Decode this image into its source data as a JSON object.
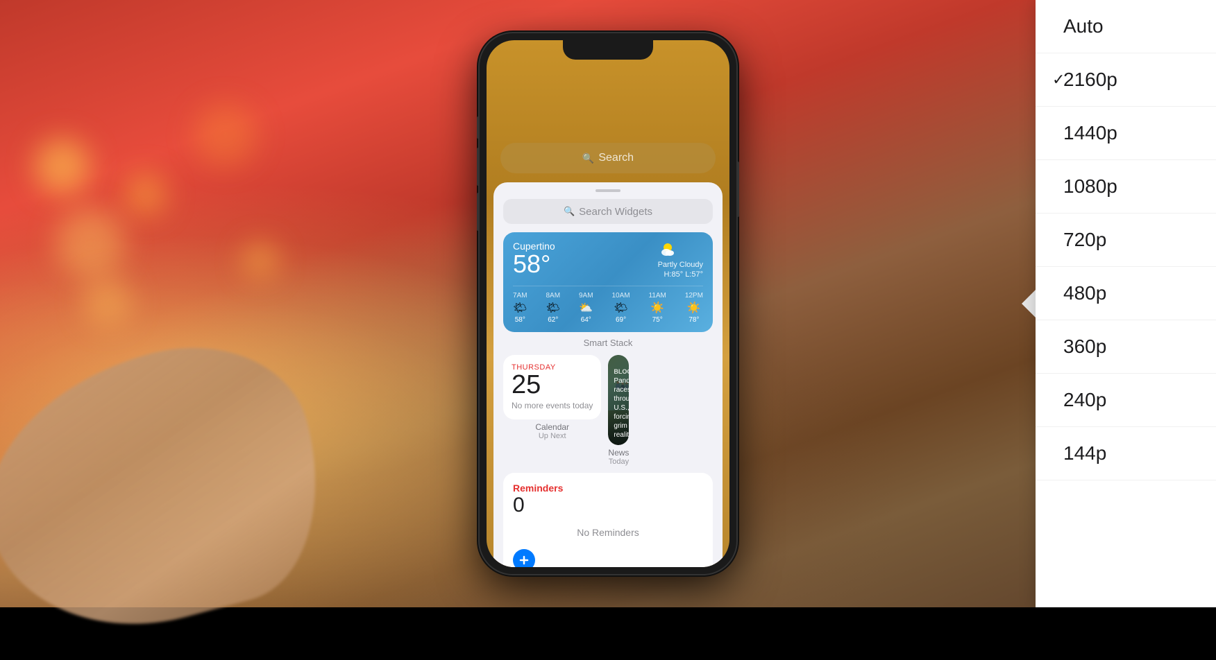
{
  "background": {
    "description": "Blurred desk with bokeh lights and warm tones"
  },
  "phone": {
    "search_text": "Search",
    "search_widgets_text": "Search Widgets",
    "weather": {
      "city": "Cupertino",
      "temperature": "58°",
      "condition": "Partly Cloudy",
      "high": "H:85°",
      "low": "L:57°",
      "forecast": [
        {
          "time": "7AM",
          "temp": "58°",
          "icon": "🌤"
        },
        {
          "time": "8AM",
          "temp": "62°",
          "icon": "🌤"
        },
        {
          "time": "9AM",
          "temp": "64°",
          "icon": "⛅"
        },
        {
          "time": "10AM",
          "temp": "69°",
          "icon": "🌤"
        },
        {
          "time": "11AM",
          "temp": "75°",
          "icon": "☀️"
        },
        {
          "time": "12PM",
          "temp": "78°",
          "icon": "☀️"
        }
      ]
    },
    "smart_stack_label": "Smart Stack",
    "calendar": {
      "day": "THURSDAY",
      "date": "25",
      "no_events": "No more events today",
      "label": "Calendar",
      "sublabel": "Up Next"
    },
    "news": {
      "source": "Bloomberg",
      "headline": "Pandemic races through U.S., forcing grim realit...",
      "label": "News",
      "sublabel": "Today"
    },
    "reminders": {
      "title": "Reminders",
      "count": "0",
      "no_reminders": "No Reminders",
      "label": "Reminders"
    }
  },
  "quality_menu": {
    "items": [
      {
        "label": "Auto",
        "checked": false
      },
      {
        "label": "2160p",
        "checked": true
      },
      {
        "label": "1440p",
        "checked": false
      },
      {
        "label": "1080p",
        "checked": false
      },
      {
        "label": "720p",
        "checked": false
      },
      {
        "label": "480p",
        "checked": false
      },
      {
        "label": "360p",
        "checked": false
      },
      {
        "label": "240p",
        "checked": false
      },
      {
        "label": "144p",
        "checked": false
      }
    ]
  }
}
